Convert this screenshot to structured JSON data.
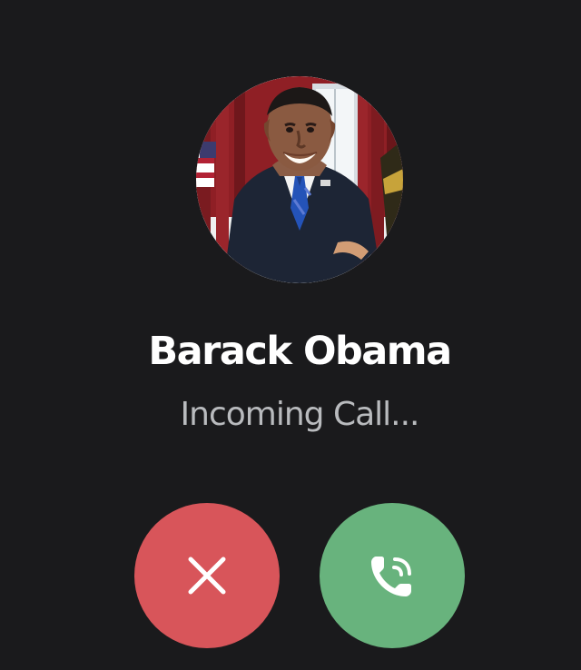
{
  "caller": {
    "name": "Barack Obama",
    "status": "Incoming Call..."
  },
  "avatar": {
    "alt": "Barack Obama"
  },
  "actions": {
    "decline": {
      "icon": "close-icon",
      "color": "#d8555a"
    },
    "accept": {
      "icon": "phone-ringing-icon",
      "color": "#68b37d"
    }
  },
  "colors": {
    "background": "#1a1a1c",
    "name": "#ffffff",
    "status": "#b9bbbe"
  }
}
